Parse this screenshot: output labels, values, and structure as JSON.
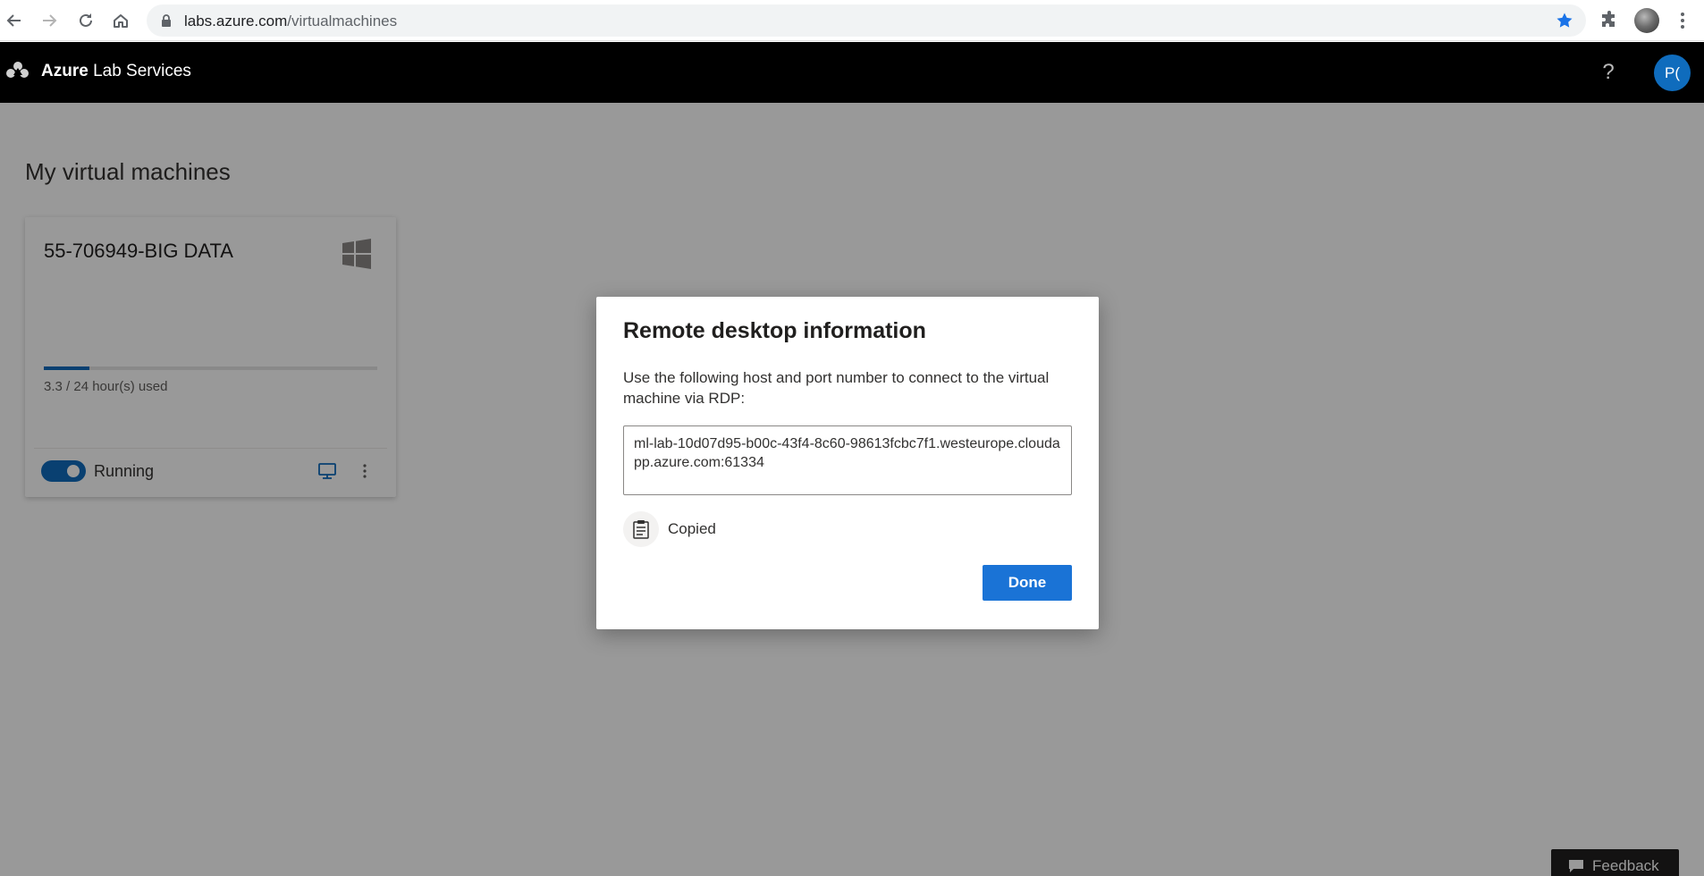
{
  "browser": {
    "url_host": "labs.azure.com",
    "url_path": "/virtualmachines"
  },
  "header": {
    "brand": "Azure",
    "product": "Lab Services",
    "help_label": "?",
    "user_initials": "P("
  },
  "page": {
    "title": "My virtual machines"
  },
  "vm_card": {
    "name": "55-706949-BIG DATA",
    "usage_text": "3.3 / 24 hour(s) used",
    "usage_hours_used": 3.3,
    "usage_hours_total": 24,
    "status": "Running",
    "running": true
  },
  "dialog": {
    "title": "Remote desktop information",
    "description": "Use the following host and port number to connect to the virtual machine via RDP:",
    "host": "ml-lab-10d07d95-b00c-43f4-8c60-98613fcbc7f1.westeurope.cloudapp.azure.com:61334",
    "copied_label": "Copied",
    "done_label": "Done"
  },
  "feedback": {
    "label": "Feedback"
  },
  "colors": {
    "accent": "#0f6cbd",
    "done_button": "#1a73d6",
    "header_bg": "#000000"
  }
}
